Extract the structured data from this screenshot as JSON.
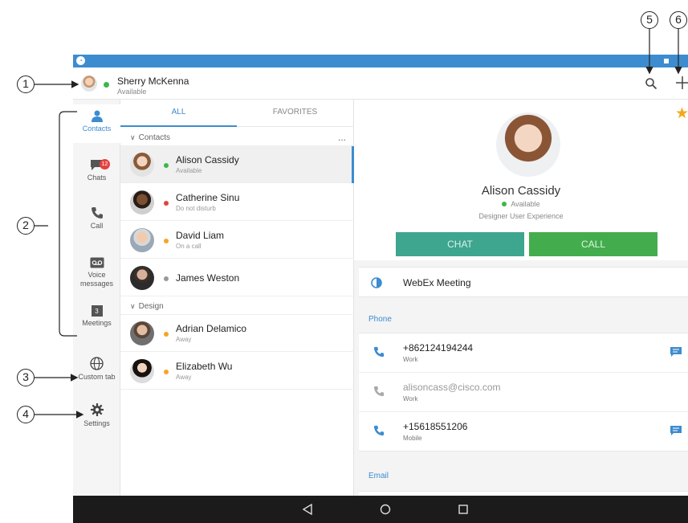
{
  "callouts": [
    "1",
    "2",
    "3",
    "4",
    "5",
    "6"
  ],
  "user": {
    "name": "Sherry McKenna",
    "status": "Available",
    "status_color": "#3db64a"
  },
  "topbar_icons": [
    "search-icon",
    "plus-icon"
  ],
  "nav": [
    {
      "label": "Contacts",
      "icon": "person-icon",
      "active": true
    },
    {
      "label": "Chats",
      "icon": "chat-bubble-icon",
      "badge": "12"
    },
    {
      "label": "Call",
      "icon": "phone-icon"
    },
    {
      "label": "Voice messages",
      "icon": "voicemail-icon"
    },
    {
      "label": "Meetings",
      "icon": "calendar-icon",
      "icon_text": "3"
    },
    {
      "label": "Custom tab",
      "icon": "globe-icon"
    },
    {
      "label": "Settings",
      "icon": "gear-icon"
    }
  ],
  "tabs": [
    {
      "label": "ALL",
      "active": true
    },
    {
      "label": "FAVORITES"
    }
  ],
  "groups": [
    {
      "label": "Contacts",
      "more": "..."
    },
    {
      "label": "Design"
    }
  ],
  "contacts": [
    {
      "name": "Alison Cassidy",
      "status": "Available",
      "color": "#3db64a"
    },
    {
      "name": "Catherine Sinu",
      "status": "Do not disturb",
      "color": "#e3423f"
    },
    {
      "name": "David Liam",
      "status": "On a call",
      "color": "#f5a623"
    },
    {
      "name": "James Weston",
      "status": "",
      "color": "#999999"
    },
    {
      "name": "Adrian Delamico",
      "status": "Away",
      "color": "#f5a623"
    },
    {
      "name": "Elizabeth Wu",
      "status": "Away",
      "color": "#f5a623"
    }
  ],
  "detail": {
    "name": "Alison Cassidy",
    "status": "Available",
    "title": "Designer User Experience",
    "chat_label": "CHAT",
    "call_label": "CALL",
    "webex_label": "WebEx Meeting",
    "phone_section": "Phone",
    "email_section": "Email",
    "phones": [
      {
        "value": "+862124194244",
        "type": "Work"
      },
      {
        "value": "alisoncass@cisco.com",
        "type": "Work"
      },
      {
        "value": "+15618551206",
        "type": "Mobile"
      }
    ]
  },
  "colors": {
    "accent": "#3c8ccf",
    "chat_button": "#3ea58f",
    "call_button": "#43ad4e",
    "favorite_star": "#f3a91c"
  }
}
